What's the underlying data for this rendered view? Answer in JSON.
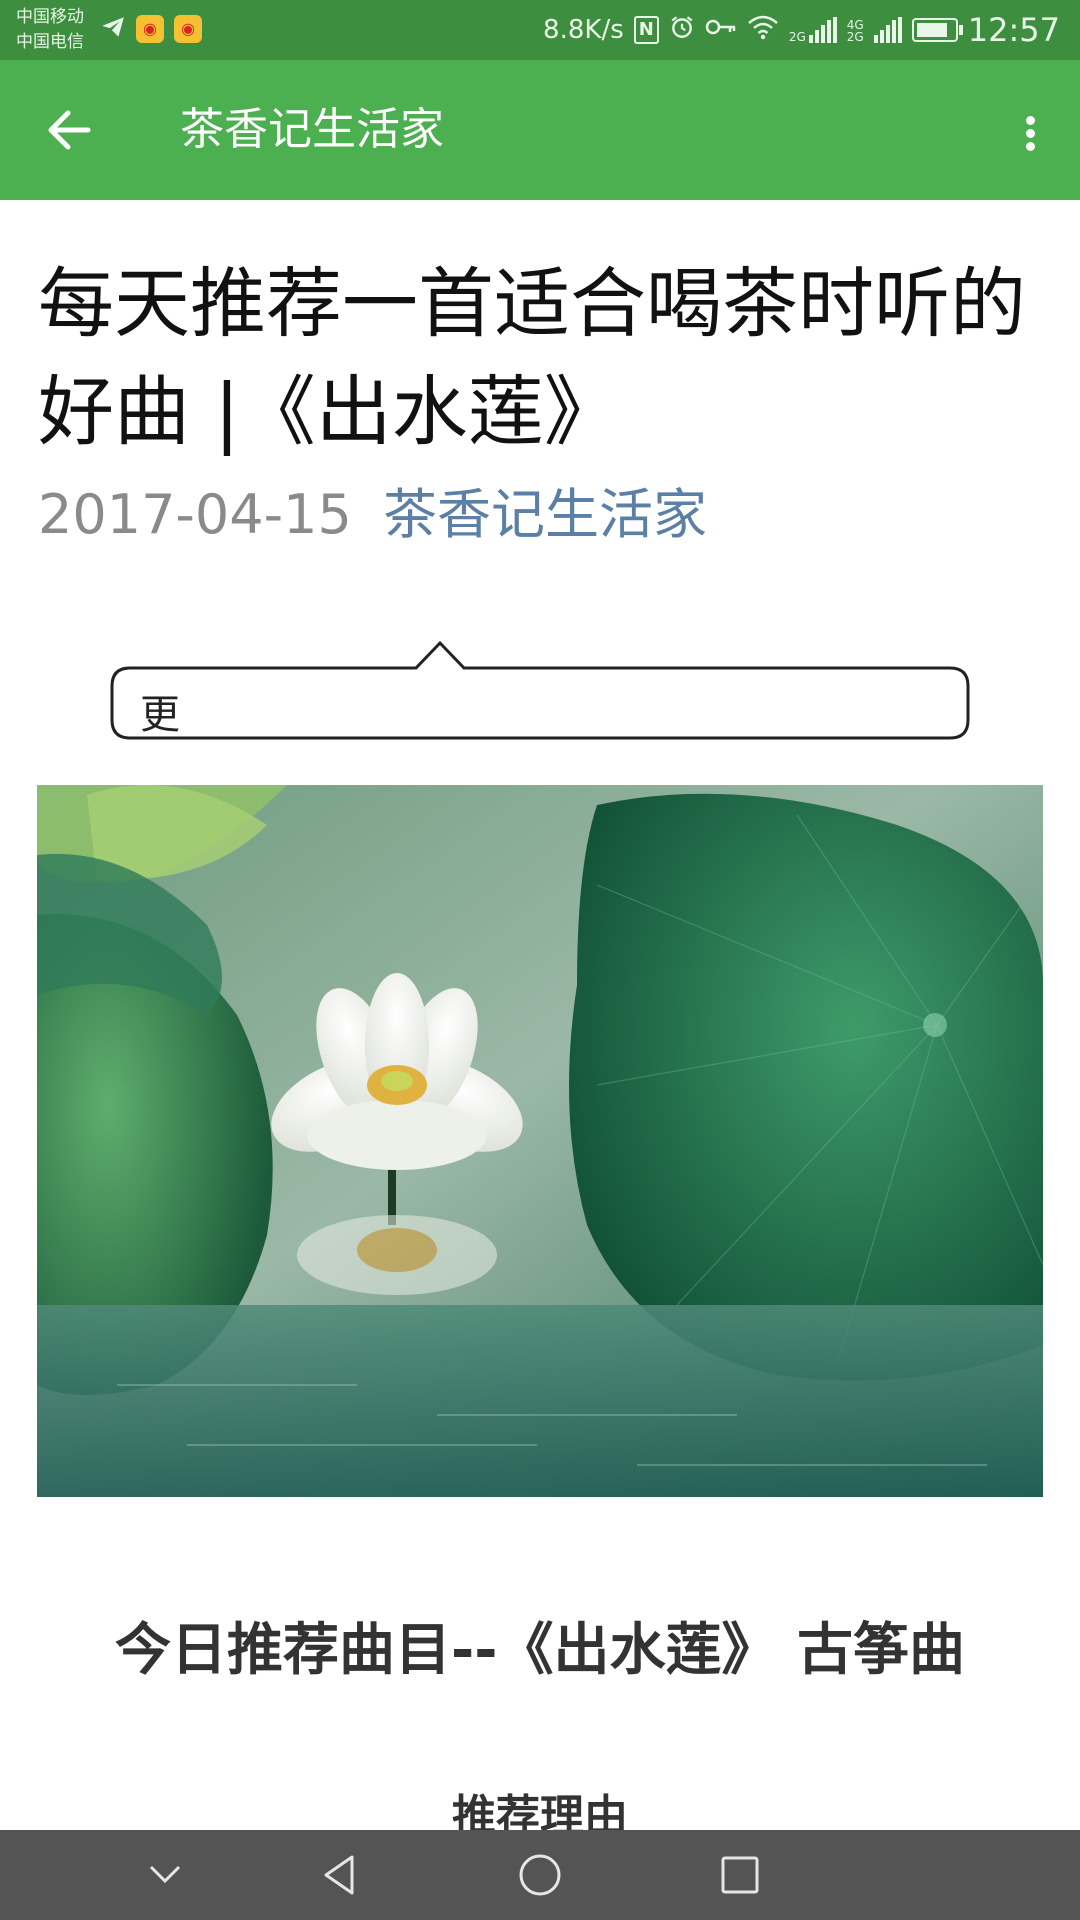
{
  "status_bar": {
    "carrier_1": "中国移动",
    "carrier_2": "中国电信",
    "net_speed": "8.8K/s",
    "nfc": "N",
    "signal_1_label": "2G",
    "signal_2_label": "4G 2G",
    "time": "12:57",
    "battery_level": 0.85,
    "icons": [
      "telegram-icon",
      "weibo-icon",
      "weibo-icon",
      "nfc-icon",
      "alarm-icon",
      "key-icon",
      "wifi-icon",
      "signal-icon",
      "signal-icon",
      "battery-icon"
    ]
  },
  "app_bar": {
    "back_icon": "arrow-left-icon",
    "title": "茶香记生活家",
    "more_icon": "more-vert-icon",
    "color": "#4caf50"
  },
  "article": {
    "title": "每天推荐一首适合喝茶时听的好曲 |《出水莲》",
    "date": "2017-04-15",
    "author": "茶香记生活家",
    "callout_text": "更",
    "image_alt": "lotus flower on water",
    "section_heading": "今日推荐曲目--《出水莲》 古筝曲",
    "subheading": "推荐理由"
  },
  "nav_bar": {
    "buttons": [
      "chevron-down-icon",
      "back-triangle-icon",
      "home-circle-icon",
      "recents-square-icon"
    ]
  }
}
